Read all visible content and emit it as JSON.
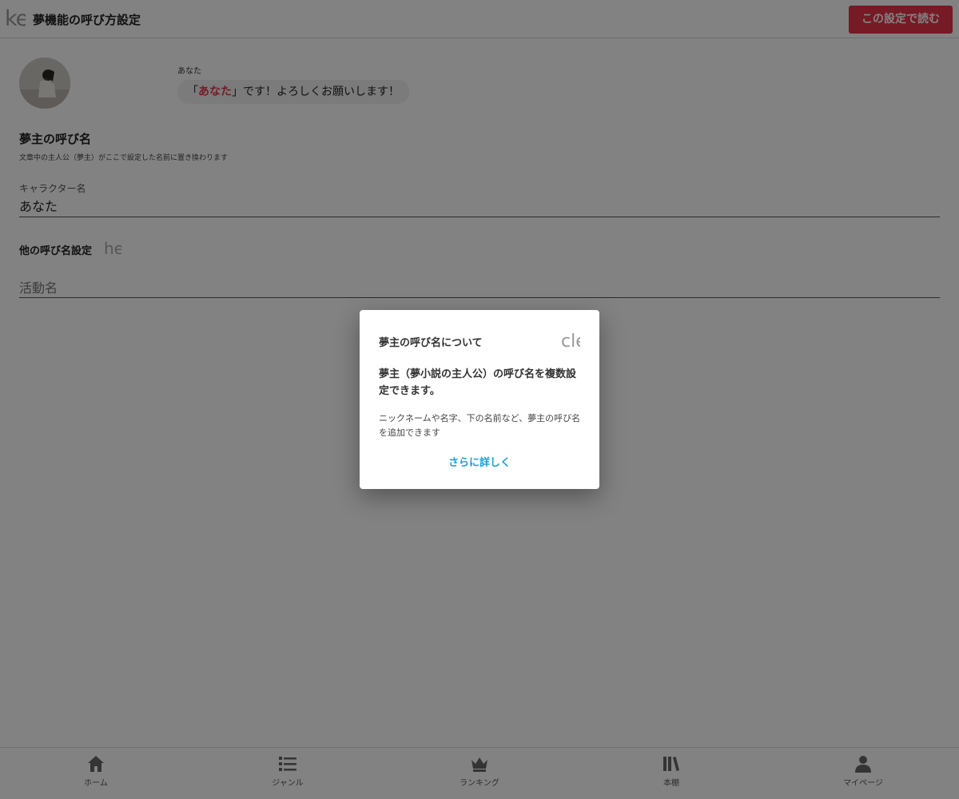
{
  "header": {
    "back_glyph": "ke",
    "title": "夢機能の呼び方設定",
    "read_button": "この設定で読む"
  },
  "preview": {
    "speaker": "あなた",
    "quote_open": "「",
    "quote_name": "あなた",
    "quote_rest": "」です！よろしくお願いします！"
  },
  "dream_name": {
    "title": "夢主の呼び名",
    "description": "文章中の主人公（夢主）がここで設定した名前に置き換わります",
    "character_label": "キャラクター名",
    "character_value": "あなた"
  },
  "alias": {
    "title": "他の呼び名設定",
    "help_glyph": "he",
    "field_value": "活動名"
  },
  "bottom_nav": {
    "items": [
      {
        "label": "ホーム",
        "icon": "home-icon"
      },
      {
        "label": "ジャンル",
        "icon": "list-icon"
      },
      {
        "label": "ランキング",
        "icon": "crown-icon"
      },
      {
        "label": "本棚",
        "icon": "bookshelf-icon"
      },
      {
        "label": "マイページ",
        "icon": "person-icon"
      }
    ]
  },
  "modal": {
    "title": "夢主の呼び名について",
    "close_glyph": "cle",
    "heading": "夢主（夢小説の主人公）の呼び名を複数設定できます。",
    "body": "ニックネームや名字、下の名前など、夢主の呼び名を追加できます",
    "link": "さらに詳しく"
  },
  "colors": {
    "accent": "#e7334a",
    "link": "#1a9fd4",
    "overlay": "rgba(0,0,0,0.49)"
  }
}
